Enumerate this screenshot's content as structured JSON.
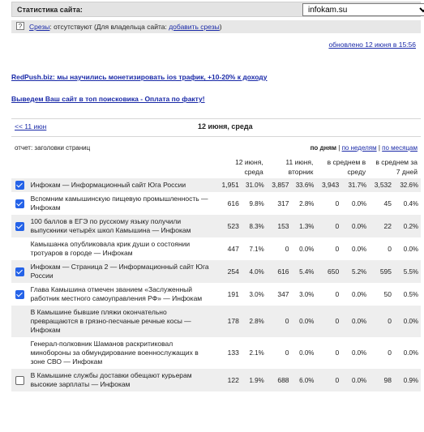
{
  "header": {
    "title": "Статистика сайта:",
    "site_selected": "infokam.su"
  },
  "sources": {
    "icon": "question-icon",
    "link_label": "Срезы",
    "text": ": отсутствуют (Для владельца сайта: ",
    "add_link": "добавить срезы",
    "close_paren": ")"
  },
  "updated": "обновлено 12 июня в 15:56",
  "promos": [
    "RedPush.biz: мы научились монетизировать ios трафик, +10-20% к доходу",
    "Выведем Ваш сайт в топ поисковика - Оплата по факту!"
  ],
  "datebar": {
    "prev": "<< 11 июн",
    "current": "12 июня, среда"
  },
  "report": {
    "label": "отчет: заголовки страниц",
    "period_current": "по дням",
    "period_weeks": "по неделям",
    "period_months": "по месяцам",
    "sep": "|"
  },
  "columns": [
    "12 июня, среда",
    "11 июня, вторник",
    "в среднем в среду",
    "в среднем за 7 дней"
  ],
  "rows": [
    {
      "title": "Инфокам — Информационный сайт Юга России",
      "checkbox": "checked",
      "v": [
        "1,951",
        "31.0%",
        "3,857",
        "33.6%",
        "3,943",
        "31.7%",
        "3,532",
        "32.6%"
      ]
    },
    {
      "title": "Вспомним камышинскую пищевую промышленность — Инфокам",
      "checkbox": "checked",
      "v": [
        "616",
        "9.8%",
        "317",
        "2.8%",
        "0",
        "0.0%",
        "45",
        "0.4%"
      ]
    },
    {
      "title": "100 баллов в ЕГЭ по русскому языку получили выпускники четырёх школ Камышина — Инфокам",
      "checkbox": "checked",
      "v": [
        "523",
        "8.3%",
        "153",
        "1.3%",
        "0",
        "0.0%",
        "22",
        "0.2%"
      ]
    },
    {
      "title": "Камышанка опубликовала крик души о состоянии тротуаров в городе — Инфокам",
      "checkbox": "none",
      "v": [
        "447",
        "7.1%",
        "0",
        "0.0%",
        "0",
        "0.0%",
        "0",
        "0.0%"
      ]
    },
    {
      "title": "Инфокам — Страница 2 — Информационный сайт Юга России",
      "checkbox": "checked",
      "v": [
        "254",
        "4.0%",
        "616",
        "5.4%",
        "650",
        "5.2%",
        "595",
        "5.5%"
      ]
    },
    {
      "title": "Глава Камышина отмечен званием «Заслуженный работник местного самоуправления РФ» — Инфокам",
      "checkbox": "checked",
      "v": [
        "191",
        "3.0%",
        "347",
        "3.0%",
        "0",
        "0.0%",
        "50",
        "0.5%"
      ]
    },
    {
      "title": "В Камышине бывшие пляжи окончательно превращаются в грязно-песчаные речные косы — Инфокам",
      "checkbox": "none",
      "v": [
        "178",
        "2.8%",
        "0",
        "0.0%",
        "0",
        "0.0%",
        "0",
        "0.0%"
      ]
    },
    {
      "title": "Генерал-полковник Шаманов раскритиковал минобороны за обмундирование военнослужащих в зоне СВО — Инфокам",
      "checkbox": "none",
      "v": [
        "133",
        "2.1%",
        "0",
        "0.0%",
        "0",
        "0.0%",
        "0",
        "0.0%"
      ]
    },
    {
      "title": "В Камышине службы доставки обещают курьерам высокие зарплаты — Инфокам",
      "checkbox": "unchecked",
      "v": [
        "122",
        "1.9%",
        "688",
        "6.0%",
        "0",
        "0.0%",
        "98",
        "0.9%"
      ]
    }
  ]
}
